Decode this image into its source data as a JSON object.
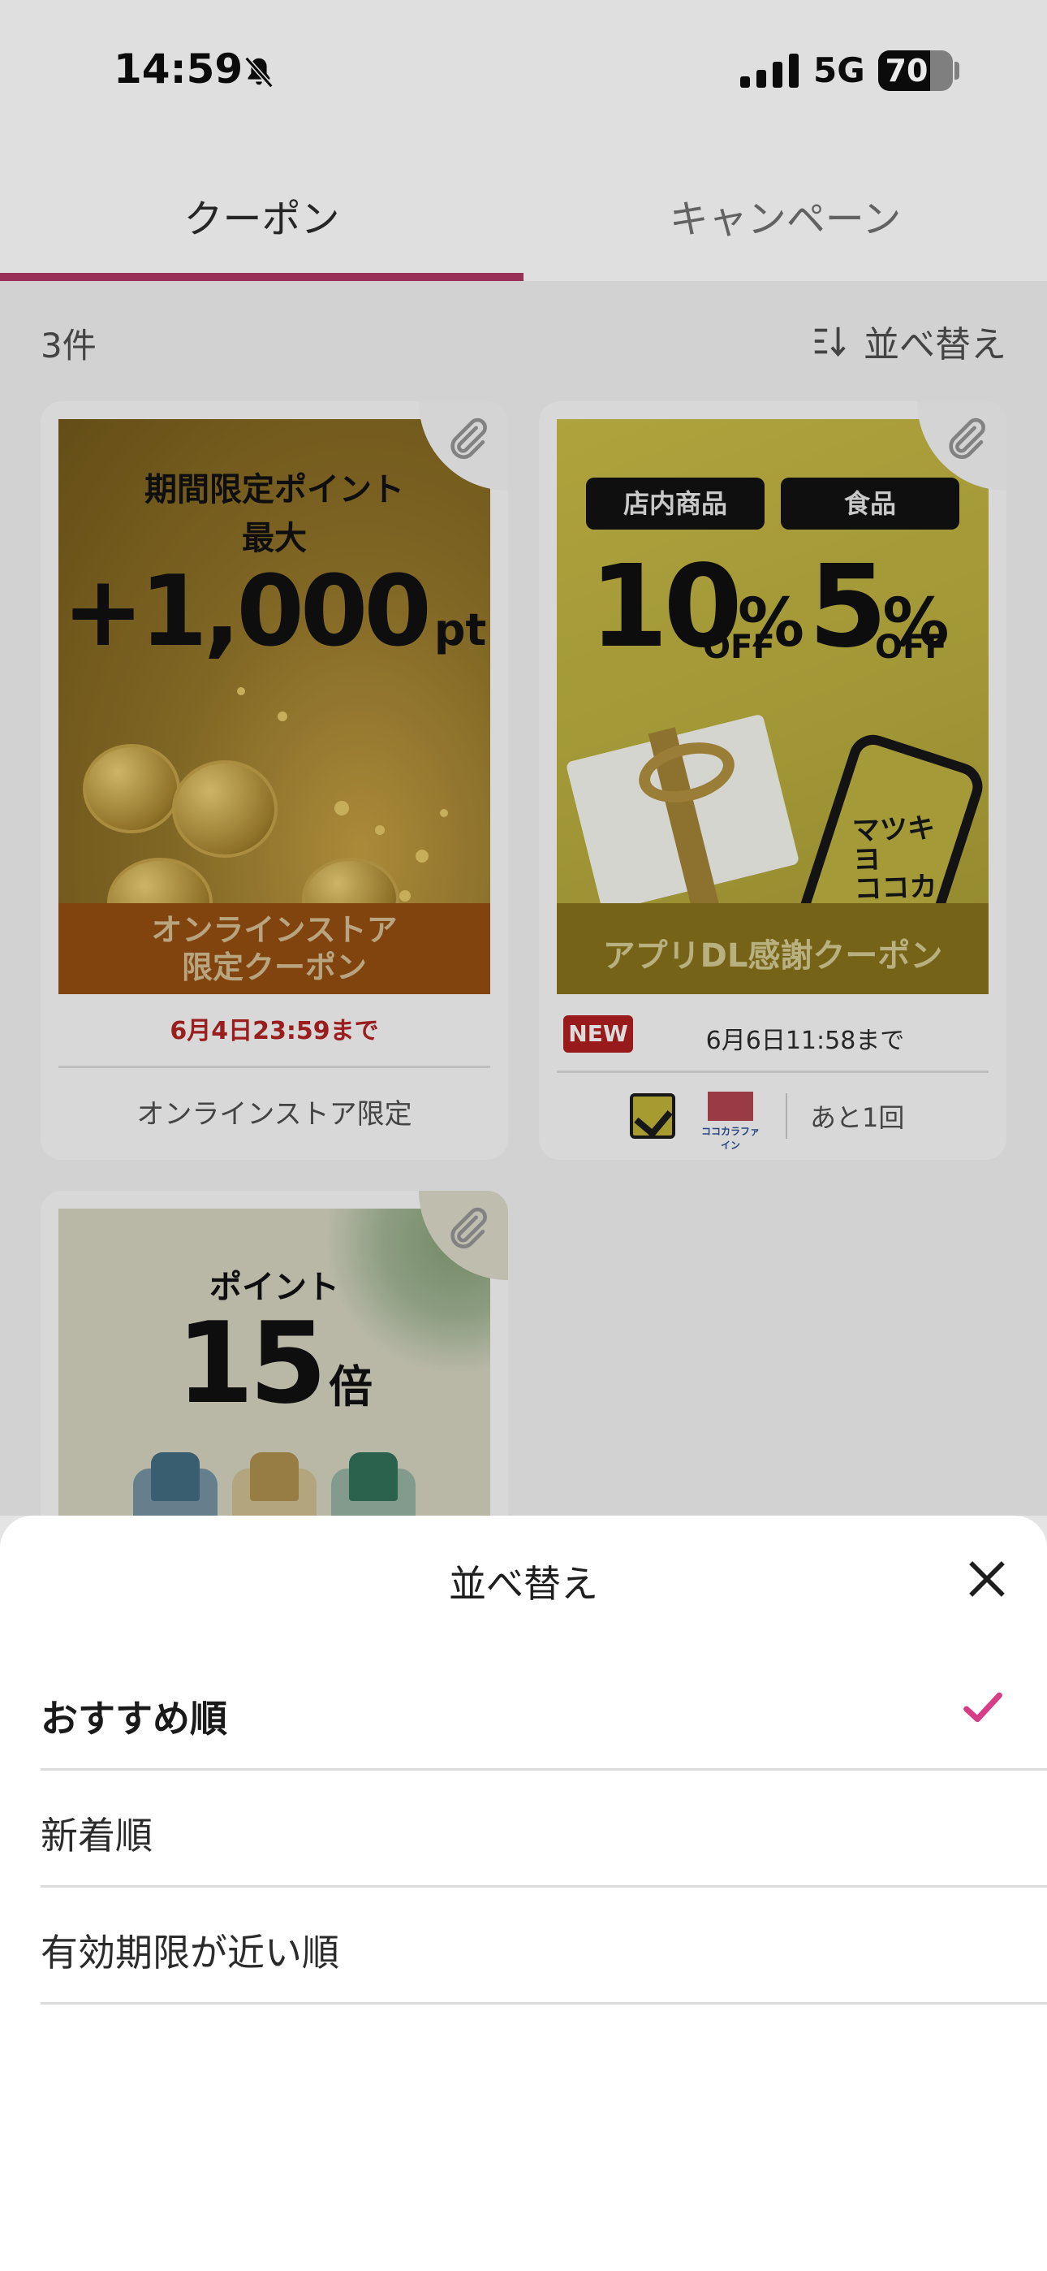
{
  "status_bar": {
    "time": "14:59",
    "network": "5G",
    "battery": "70",
    "battery_level": 0.7
  },
  "tabs": [
    {
      "label": "クーポン",
      "active": true
    },
    {
      "label": "キャンペーン",
      "active": false
    }
  ],
  "list": {
    "count": "3件",
    "sort_label": "並べ替え"
  },
  "cards": [
    {
      "title_line1": "期間限定ポイント",
      "title_line2": "最大",
      "points": "+1,000",
      "points_unit": "pt",
      "banner_line1": "オンラインストア",
      "banner_line2": "限定クーポン",
      "expiry": "6月4日23:59まで",
      "footer": "オンラインストア限定"
    },
    {
      "tag_left": "店内商品",
      "tag_right": "食品",
      "pct_left": "10",
      "pct_right": "5",
      "pct_symbol": "%",
      "off_label": "OFF",
      "phone_logo": "マツキヨ\nココカラ",
      "banner": "アプリDL感謝クーポン",
      "new_badge": "NEW",
      "expiry": "6月6日11:58まで",
      "logo_cf_text": "ココカラファイン",
      "remaining": "あと1回"
    },
    {
      "title": "ポイント",
      "multiplier": "15",
      "multiplier_unit": "倍"
    }
  ],
  "sheet": {
    "title": "並べ替え",
    "options": [
      {
        "label": "おすすめ順",
        "selected": true
      },
      {
        "label": "新着順",
        "selected": false
      },
      {
        "label": "有効期限が近い順",
        "selected": false
      }
    ]
  },
  "colors": {
    "accent_tab": "#a4335e",
    "check": "#d63d86",
    "expiry_red": "#a82121"
  },
  "icons": [
    "bell-slash-icon",
    "signal-icon",
    "sort-icon",
    "paperclip-icon",
    "close-icon",
    "check-icon"
  ]
}
